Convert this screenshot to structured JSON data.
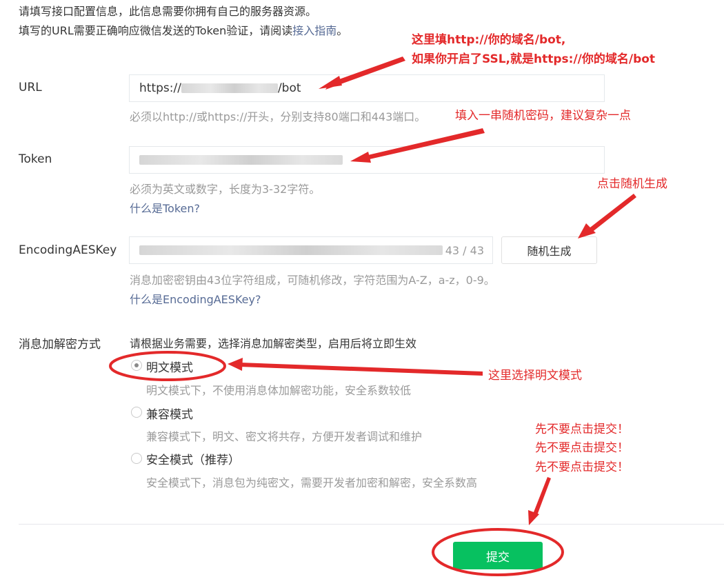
{
  "intro": {
    "line1": "请填写接口配置信息，此信息需要你拥有自己的服务器资源。",
    "line2_prefix": "填写的URL需要正确响应微信发送的Token验证，请阅读",
    "line2_link": "接入指南",
    "line2_suffix": "。"
  },
  "url": {
    "label": "URL",
    "value_prefix": "https://",
    "value_suffix": "/bot",
    "tip": "必须以http://或https://开头，分别支持80端口和443端口。"
  },
  "token": {
    "label": "Token",
    "tip": "必须为英文或数字，长度为3-32字符。",
    "help_link": "什么是Token?"
  },
  "aes": {
    "label": "EncodingAESKey",
    "counter": "43 / 43",
    "random_button": "随机生成",
    "tip": "消息加密密钥由43位字符组成，可随机修改，字符范围为A-Z，a-z，0-9。",
    "help_link": "什么是EncodingAESKey?"
  },
  "mode": {
    "label": "消息加解密方式",
    "description": "请根据业务需要，选择消息加解密类型，启用后将立即生效",
    "options": [
      {
        "label": "明文模式",
        "desc": "明文模式下，不使用消息体加解密功能，安全系数较低",
        "checked": true
      },
      {
        "label": "兼容模式",
        "desc": "兼容模式下，明文、密文将共存，方便开发者调试和维护",
        "checked": false
      },
      {
        "label": "安全模式（推荐）",
        "desc": "安全模式下，消息包为纯密文，需要开发者加密和解密，安全系数高",
        "checked": false
      }
    ]
  },
  "submit_button": "提交",
  "annotations": {
    "url_note_1": "这里填http://你的域名/bot,",
    "url_note_2": "如果你开启了SSL,就是https://你的域名/bot",
    "token_note": "填入一串随机密码，建议复杂一点",
    "aes_note": "点击随机生成",
    "mode_note": "这里选择明文模式",
    "submit_note_1": "先不要点击提交！",
    "submit_note_2": "先不要点击提交！",
    "submit_note_3": "先不要点击提交！"
  },
  "colors": {
    "annotation_red": "#e3292a",
    "primary_green": "#07c160",
    "link_blue": "#576b95"
  }
}
